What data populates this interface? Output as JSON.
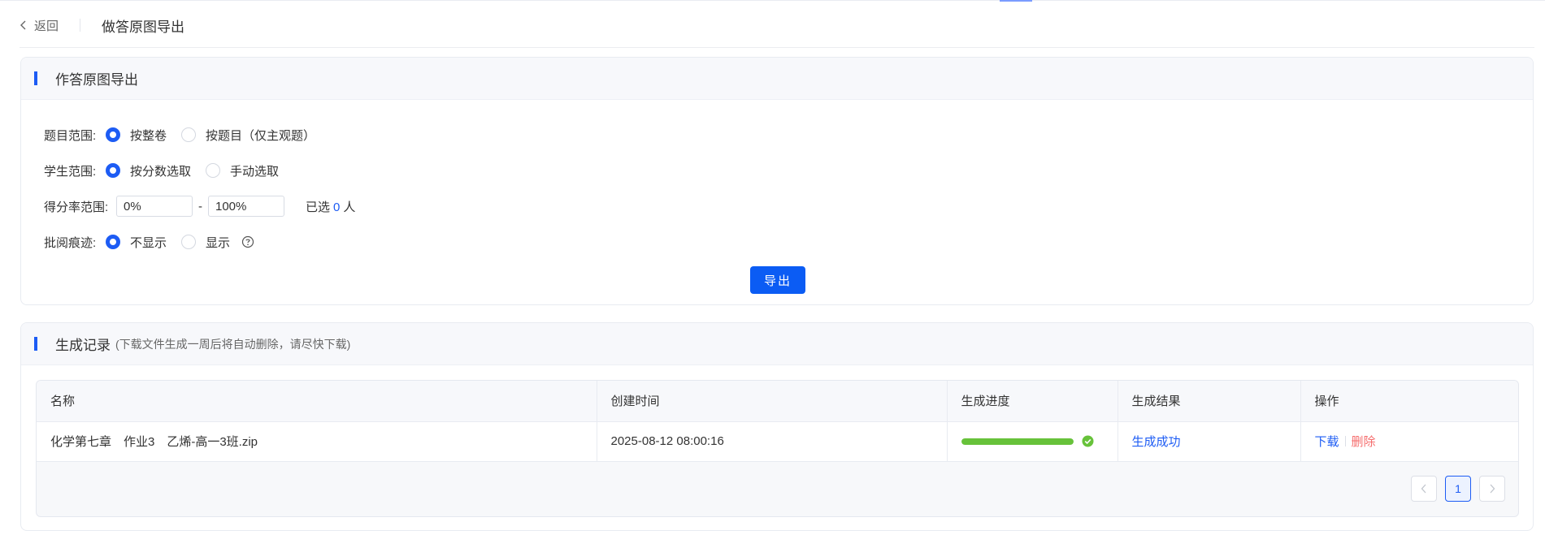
{
  "header": {
    "back_label": "返回",
    "title": "做答原图导出"
  },
  "export_card": {
    "title": "作答原图导出",
    "question_scope": {
      "label": "题目范围:",
      "options": [
        "按整卷",
        "按题目（仅主观题）"
      ],
      "selected": "按整卷"
    },
    "student_scope": {
      "label": "学生范围:",
      "options": [
        "按分数选取",
        "手动选取"
      ],
      "selected": "按分数选取"
    },
    "score_range": {
      "label": "得分率范围:",
      "min": "0%",
      "separator": "-",
      "max": "100%",
      "selected_prefix": "已选",
      "selected_count": "0",
      "selected_suffix": "人"
    },
    "marking_trace": {
      "label": "批阅痕迹:",
      "options": [
        "不显示",
        "显示"
      ],
      "selected": "不显示"
    },
    "export_button": "导出"
  },
  "records_card": {
    "title": "生成记录",
    "subtitle": "(下载文件生成一周后将自动删除，请尽快下载)",
    "columns": [
      "名称",
      "创建时间",
      "生成进度",
      "生成结果",
      "操作"
    ],
    "rows": [
      {
        "name": "化学第七章　作业3　乙烯-高一3班.zip",
        "created": "2025-08-12 08:00:16",
        "progress": 1.0,
        "result": "生成成功",
        "action_download": "下载",
        "action_delete": "删除"
      }
    ],
    "pagination": {
      "current": "1"
    }
  },
  "colors": {
    "primary": "#1d5cf4",
    "success": "#67c23a",
    "danger": "#f56c6c"
  }
}
